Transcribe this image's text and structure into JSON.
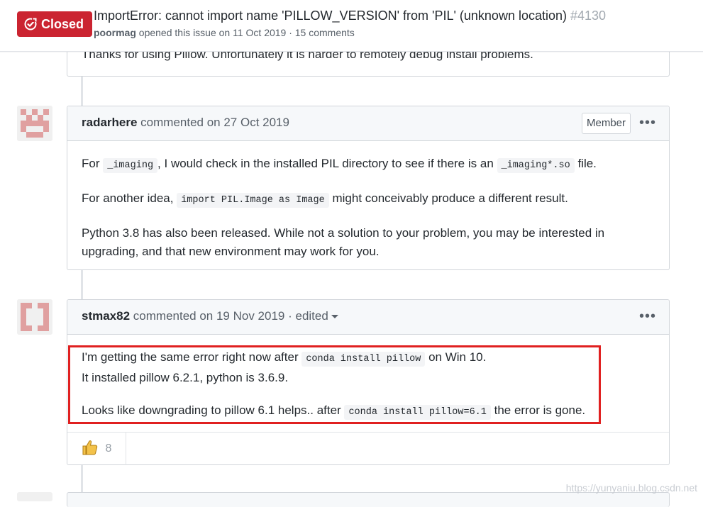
{
  "issue": {
    "state": "Closed",
    "title": "ImportError: cannot import name 'PILLOW_VERSION' from 'PIL' (unknown location)",
    "number": "#4130",
    "author": "poormag",
    "meta_text": " opened this issue on 11 Oct 2019 · 15 comments"
  },
  "previous_comment": {
    "text": "Thanks for using Pillow. Unfortunately it is harder to remotely debug install problems."
  },
  "comments": [
    {
      "author": "radarhere",
      "action": " commented on 27 Oct 2019",
      "role": "Member",
      "paragraphs": [
        {
          "pre": "For ",
          "code1": "_imaging",
          "mid": ", I would check in the installed PIL directory to see if there is an ",
          "code2": "_imaging*.so",
          "post": " file."
        },
        {
          "pre": "For another idea, ",
          "code1": "import PIL.Image as Image",
          "post": " might conceivably produce a different result."
        },
        {
          "line1": "Python 3.8 has also been released. While not a solution to your problem, you may be interested in",
          "line2": "upgrading, and that new environment may work for you."
        }
      ]
    },
    {
      "author": "stmax82",
      "action": " commented on 19 Nov 2019 · ",
      "edited": "edited",
      "paragraphs": [
        {
          "pre": "I'm getting the same error right now after ",
          "code1": "conda install pillow",
          "post": " on Win 10."
        },
        {
          "line": "It installed pillow 6.2.1, python is 3.6.9."
        },
        {
          "pre": "Looks like downgrading to pillow 6.1 helps.. after ",
          "code1": "conda install pillow=6.1",
          "post": " the error is gone."
        }
      ],
      "reactions": [
        {
          "icon": "thumbs-up",
          "count": "8"
        }
      ]
    }
  ],
  "watermark": "https://yunyaniu.blog.csdn.net",
  "colors": {
    "closed": "#cb2431",
    "highlight": "#e02020",
    "header_bg": "#f6f8fa"
  }
}
